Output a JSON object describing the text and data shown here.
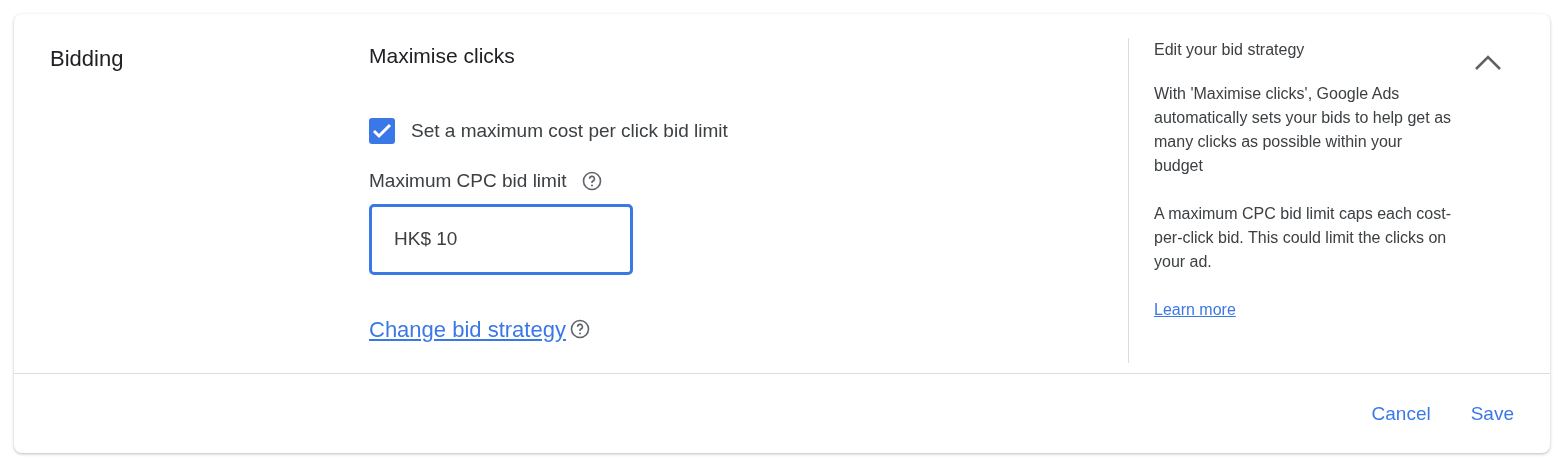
{
  "section": {
    "title": "Bidding",
    "expanded": true
  },
  "strategy": {
    "title": "Maximise clicks",
    "limit_checkbox": {
      "label": "Set a maximum cost per click bid limit",
      "checked": true
    },
    "bid_field": {
      "label": "Maximum CPC bid limit",
      "value": "HK$ 10"
    },
    "change_link": "Change bid strategy "
  },
  "help": {
    "title": "Edit your bid strategy",
    "paragraphs": [
      "With 'Maximise clicks', Google Ads automatically sets your bids to help get as many clicks as possible within your budget",
      "A maximum CPC bid limit caps each cost-per-click bid. This could limit the clicks on your ad."
    ],
    "link": "Learn more"
  },
  "buttons": [
    "Cancel",
    "Save"
  ]
}
